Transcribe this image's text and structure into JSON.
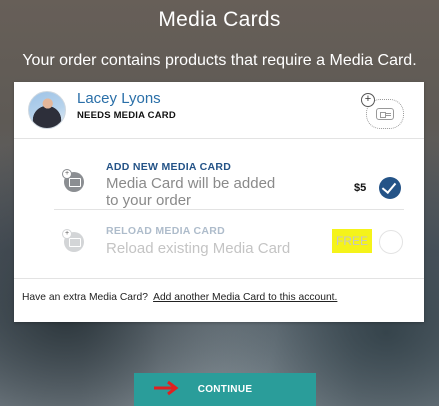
{
  "page": {
    "title": "Media Cards",
    "subtitle": "Your order contains products that require a Media Card."
  },
  "person": {
    "name": "Lacey Lyons",
    "status": "NEEDS MEDIA CARD"
  },
  "options": [
    {
      "title": "ADD NEW MEDIA CARD",
      "description": "Media Card will be added to your order",
      "price": "$5",
      "selected": true
    },
    {
      "title": "RELOAD MEDIA CARD",
      "description": "Reload existing Media Card",
      "price": "FREE",
      "selected": false
    }
  ],
  "footer": {
    "prompt": "Have an extra Media Card?",
    "link": "Add another Media Card to this account."
  },
  "continue_button": {
    "label": "CONTINUE"
  },
  "colors": {
    "accent_teal": "#2a9d9a",
    "link_blue": "#2a6fa8",
    "check_blue": "#245387",
    "highlight_yellow": "#f5f31a",
    "annotation_red": "#e02020"
  },
  "icons": {
    "media_card": "media-card-icon",
    "checkmark": "checkmark-icon",
    "arrow": "red-arrow-icon"
  }
}
